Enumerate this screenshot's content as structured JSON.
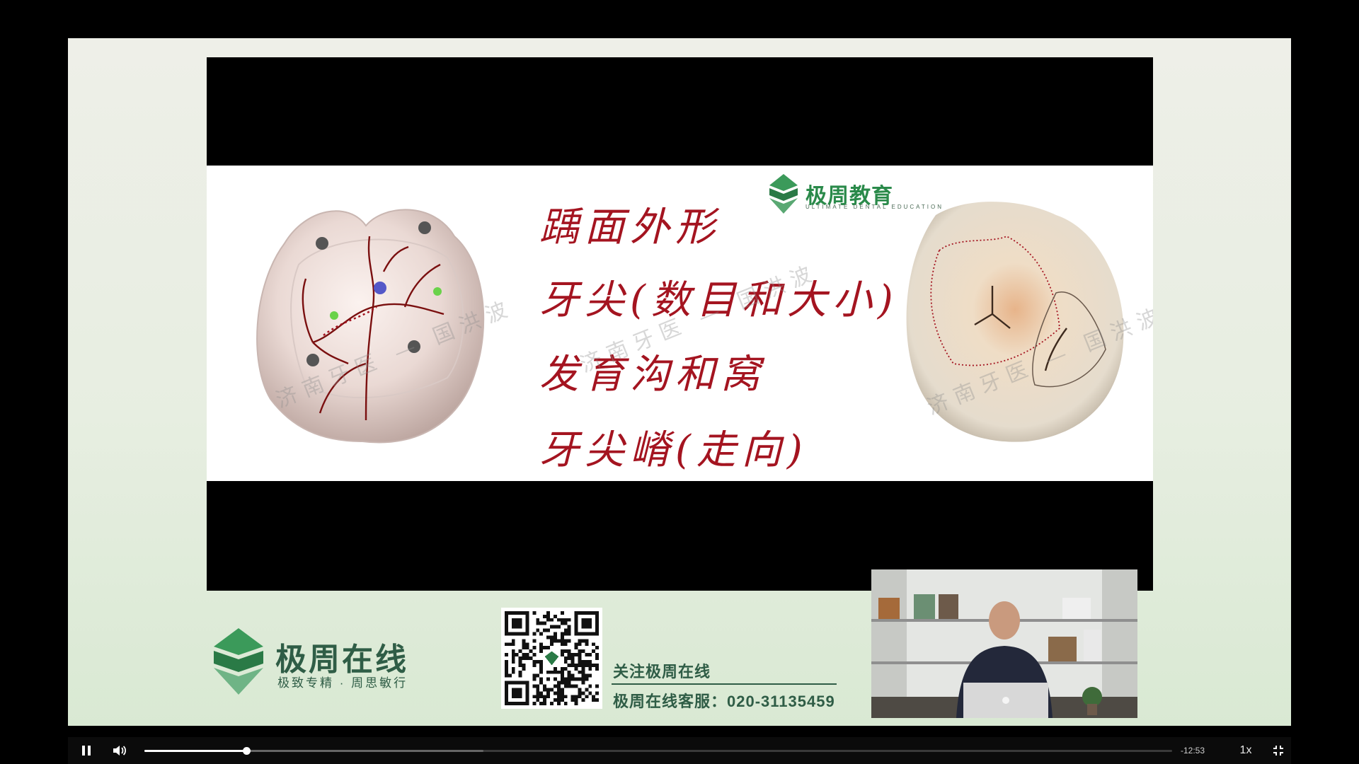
{
  "slide": {
    "lines": [
      "踽面外形",
      "牙尖(数目和大小)",
      "发育沟和窝",
      "牙尖嵴(走向)"
    ],
    "brand_name": "极周教育",
    "brand_sub": "ULTIMATE DENTAL EDUCATION",
    "watermark": "济南牙医 — 国洪波"
  },
  "footer": {
    "brand_name": "极周在线",
    "slogan": "极致专精 · 周思敏行",
    "qr_caption": "关注极周在线",
    "service": "极周在线客服：020-31135459"
  },
  "player": {
    "state": "playing",
    "play_icon": "pause-icon",
    "volume_icon": "speaker-icon",
    "exit_icon": "exit-fullscreen-icon",
    "progress": 0.099,
    "buffered": 0.33,
    "time_remaining": "-12:53",
    "speed": "1x"
  },
  "colors": {
    "accent_red": "#a41420",
    "brand_green": "#2f5d46"
  }
}
